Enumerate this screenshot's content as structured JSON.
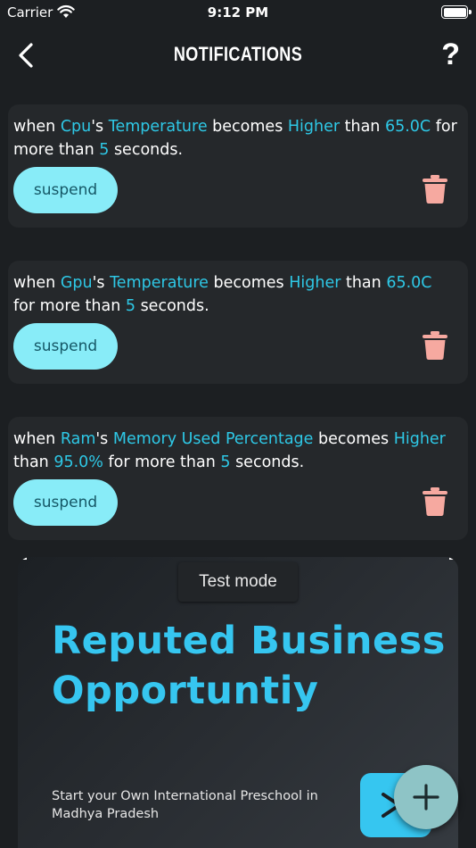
{
  "status_bar": {
    "carrier": "Carrier",
    "time": "9:12 PM"
  },
  "nav": {
    "title": "NOTIFICATIONS",
    "help": "?"
  },
  "notifications": [
    {
      "parts": [
        {
          "text": "when ",
          "hl": false
        },
        {
          "text": "Cpu",
          "hl": true
        },
        {
          "text": "'s ",
          "hl": false
        },
        {
          "text": "Temperature",
          "hl": true
        },
        {
          "text": " becomes ",
          "hl": false
        },
        {
          "text": "Higher",
          "hl": true
        },
        {
          "text": " than ",
          "hl": false
        },
        {
          "text": "65.0C",
          "hl": true
        },
        {
          "text": " for more than ",
          "hl": false
        },
        {
          "text": "5",
          "hl": true
        },
        {
          "text": " seconds.",
          "hl": false
        }
      ],
      "button": "suspend"
    },
    {
      "parts": [
        {
          "text": "when ",
          "hl": false
        },
        {
          "text": "Gpu",
          "hl": true
        },
        {
          "text": "'s ",
          "hl": false
        },
        {
          "text": "Temperature",
          "hl": true
        },
        {
          "text": " becomes ",
          "hl": false
        },
        {
          "text": "Higher",
          "hl": true
        },
        {
          "text": " than ",
          "hl": false
        },
        {
          "text": "65.0C",
          "hl": true
        },
        {
          "text": " for more than ",
          "hl": false
        },
        {
          "text": "5",
          "hl": true
        },
        {
          "text": " seconds.",
          "hl": false
        }
      ],
      "button": "suspend"
    },
    {
      "parts": [
        {
          "text": "when ",
          "hl": false
        },
        {
          "text": "Ram",
          "hl": true
        },
        {
          "text": "'s ",
          "hl": false
        },
        {
          "text": "Memory Used Percentage",
          "hl": true
        },
        {
          "text": " becomes ",
          "hl": false
        },
        {
          "text": "Higher",
          "hl": true
        },
        {
          "text": " than ",
          "hl": false
        },
        {
          "text": "95.0%",
          "hl": true
        },
        {
          "text": " for more than ",
          "hl": false
        },
        {
          "text": "5",
          "hl": true
        },
        {
          "text": " seconds.",
          "hl": false
        }
      ],
      "button": "suspend"
    }
  ],
  "ad": {
    "badge": "Test mode",
    "headline": "Reputed Business Opportuntiy",
    "subtext": "Start your Own International Preschool in Madhya Pradesh"
  },
  "colors": {
    "background": "#1c1f22",
    "card": "#25282b",
    "highlight": "#2ec8e6",
    "suspend_button": "#88ecf8",
    "trash_icon": "#f6a9a0",
    "fab": "#8ec4c6",
    "ad_accent": "#36c6f0"
  },
  "icons": {
    "back": "chevron-left-icon",
    "help": "question-mark-icon",
    "trash": "trash-icon",
    "fab": "plus-icon",
    "ad_cta": "arrow-icon"
  }
}
